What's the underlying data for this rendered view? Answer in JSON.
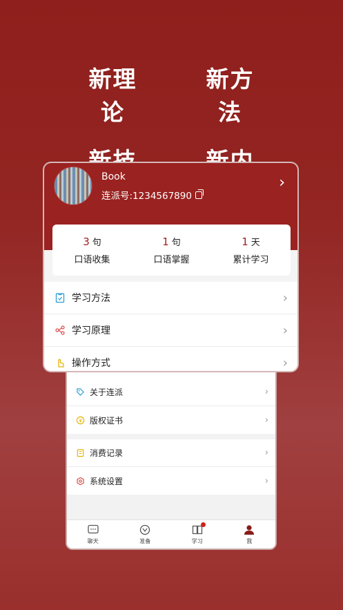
{
  "hero": {
    "line1_left": "新理论",
    "line1_right": "新方法",
    "line2_left": "新技术",
    "line2_right": "新内容"
  },
  "profile": {
    "name": "Book",
    "id_text": "连派号:1234567890"
  },
  "stats": [
    {
      "value": "3",
      "unit": "句",
      "label": "口语收集"
    },
    {
      "value": "1",
      "unit": "句",
      "label": "口语掌握"
    },
    {
      "value": "1",
      "unit": "天",
      "label": "累计学习"
    }
  ],
  "menu": [
    {
      "label": "学习方法",
      "icon": "clipboard-icon"
    },
    {
      "label": "学习原理",
      "icon": "molecule-icon"
    },
    {
      "label": "操作方式",
      "icon": "hand-pointer-icon"
    }
  ],
  "back_menu": {
    "group1": [
      {
        "label": "关于连派",
        "icon": "tag-icon"
      },
      {
        "label": "版权证书",
        "icon": "coin-icon"
      }
    ],
    "group2": [
      {
        "label": "消费记录",
        "icon": "receipt-icon"
      },
      {
        "label": "系统设置",
        "icon": "settings-icon"
      }
    ]
  },
  "tabs": [
    {
      "label": "聊天",
      "icon": "chat-icon"
    },
    {
      "label": "准备",
      "icon": "prepare-icon"
    },
    {
      "label": "学习",
      "icon": "book-icon",
      "badge": true
    },
    {
      "label": "我",
      "icon": "person-icon"
    }
  ],
  "colors": {
    "brand_red": "#9a2220",
    "accent_red": "#a11e1c"
  }
}
